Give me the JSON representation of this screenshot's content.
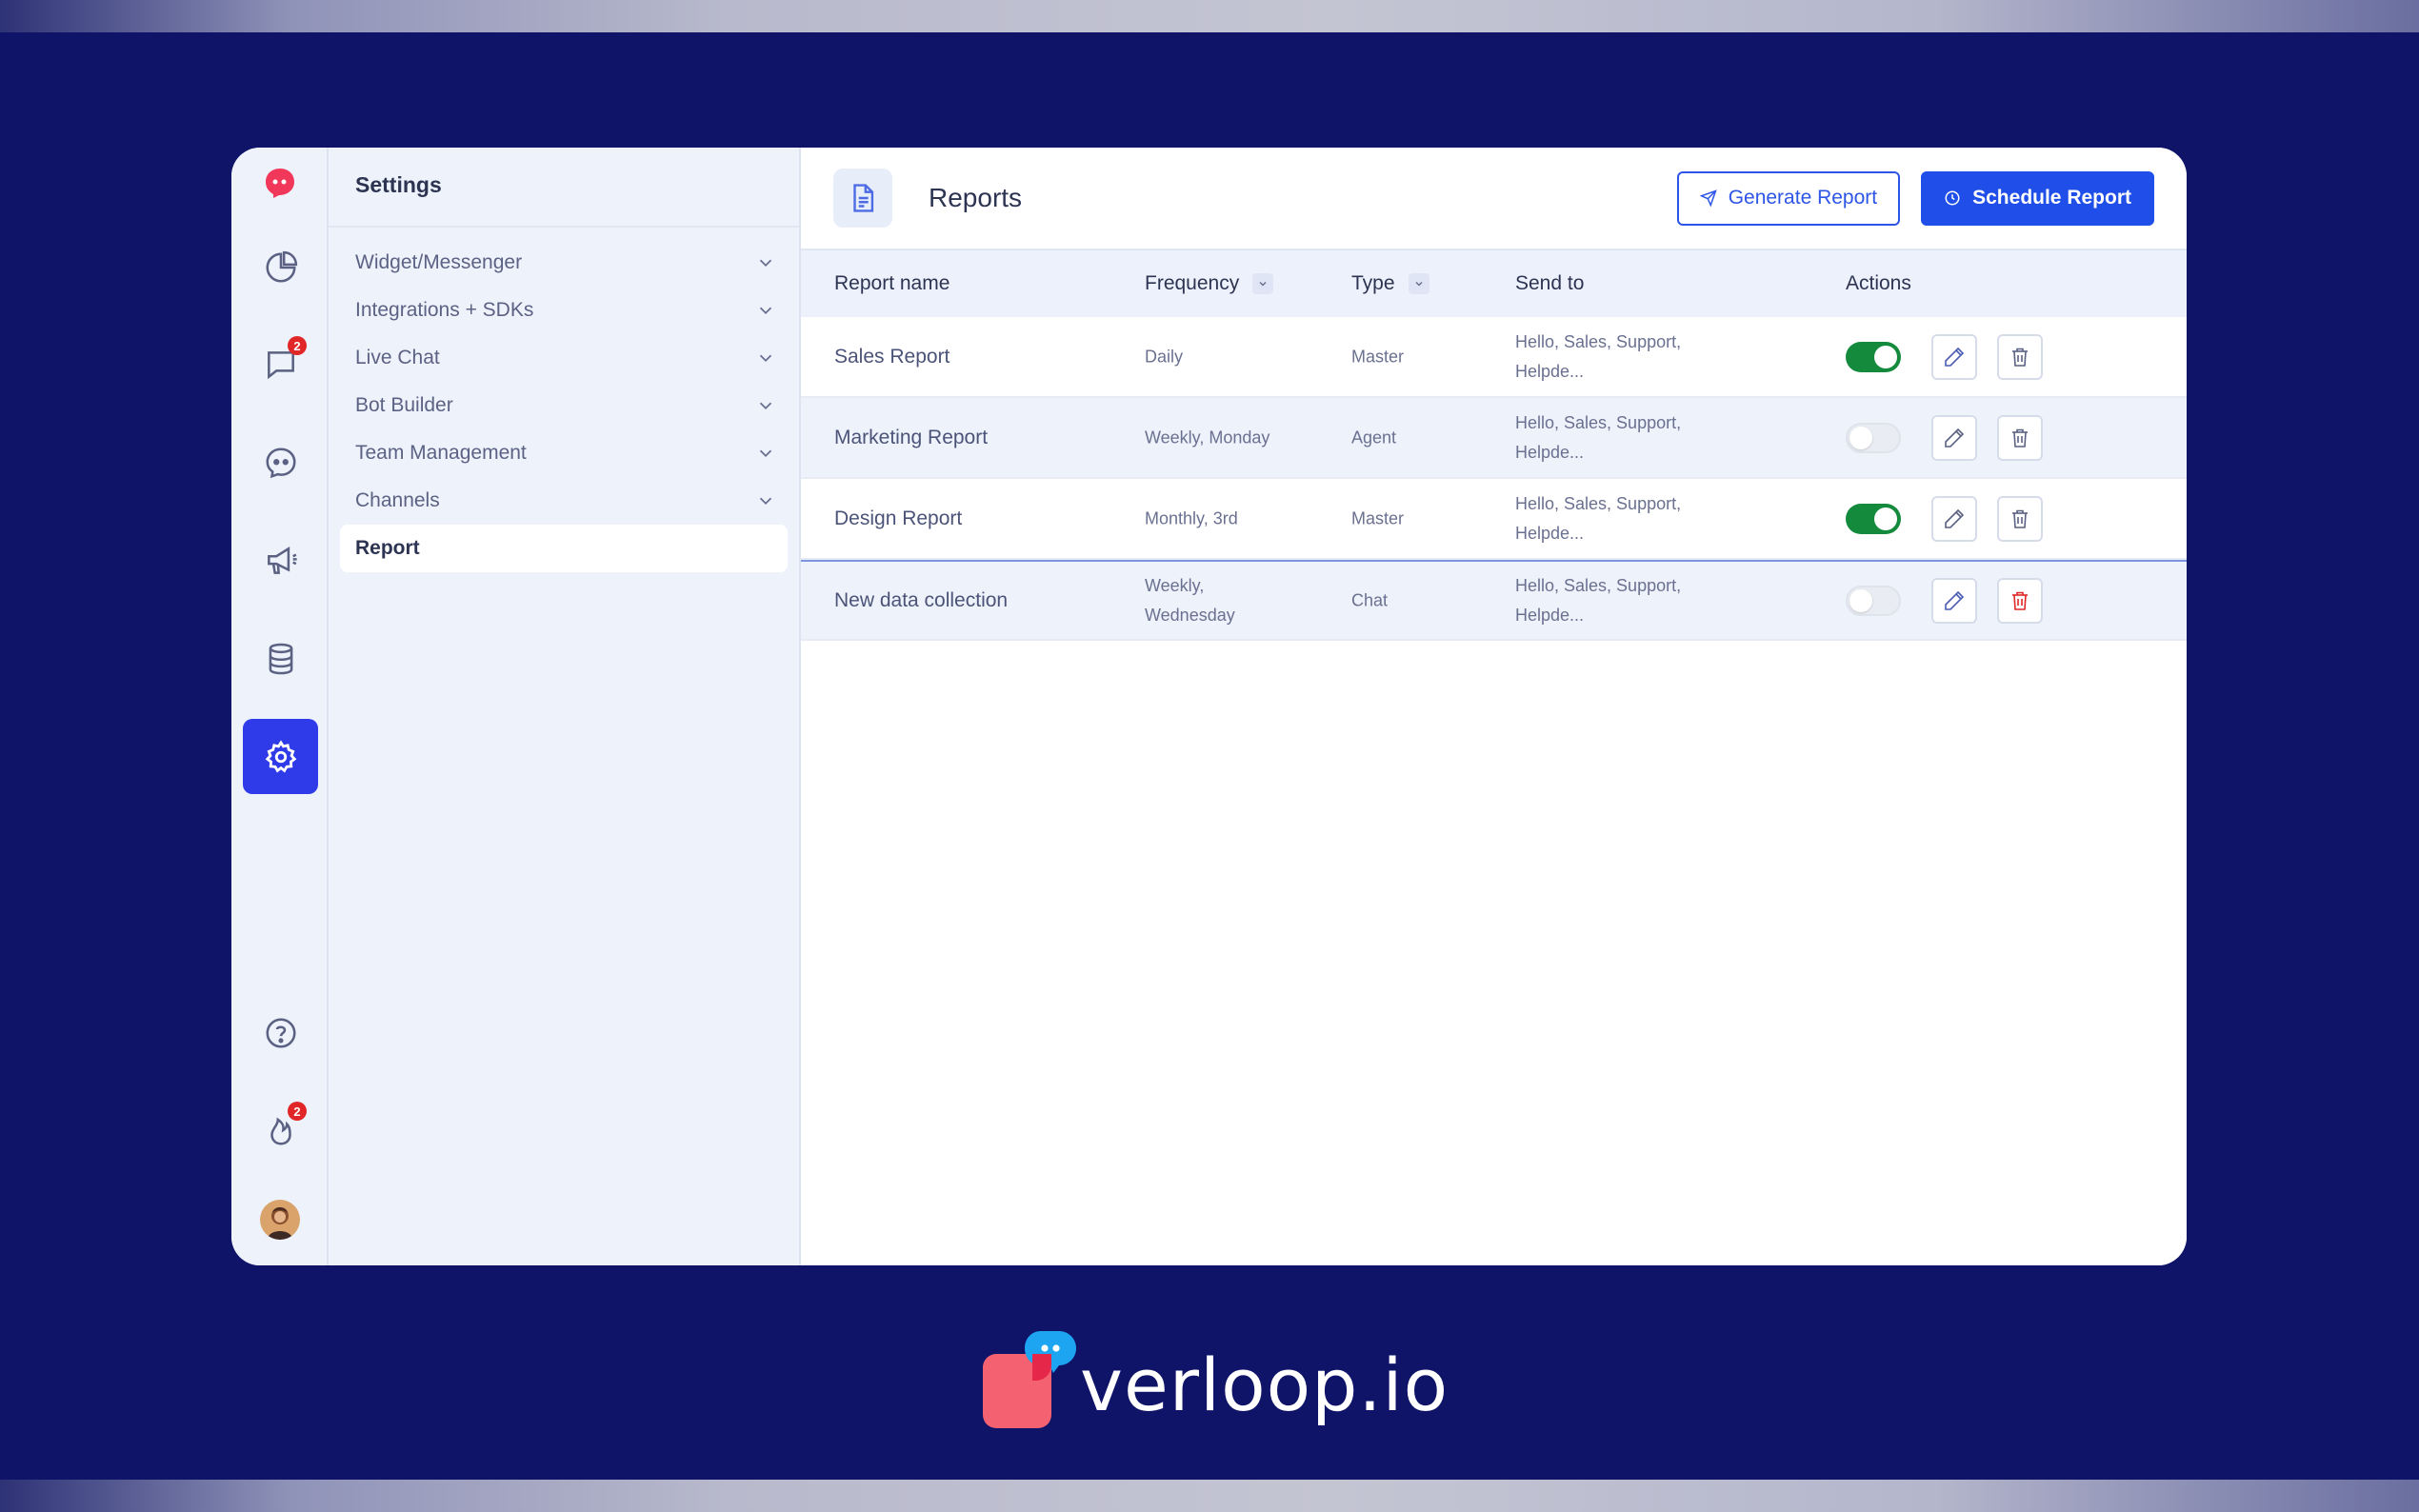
{
  "settings": {
    "title": "Settings",
    "menu": [
      {
        "label": "Widget/Messenger"
      },
      {
        "label": "Integrations + SDKs"
      },
      {
        "label": "Live Chat"
      },
      {
        "label": "Bot Builder"
      },
      {
        "label": "Team Management"
      },
      {
        "label": "Channels"
      },
      {
        "label": "Report"
      }
    ]
  },
  "rail": {
    "chat_badge": "2",
    "notif_badge": "2"
  },
  "main": {
    "title": "Reports",
    "generate_label": "Generate Report",
    "schedule_label": "Schedule Report",
    "columns": {
      "name": "Report name",
      "frequency": "Frequency",
      "type": "Type",
      "send_to": "Send to",
      "actions": "Actions"
    },
    "rows": [
      {
        "name": "Sales Report",
        "frequency": "Daily",
        "type": "Master",
        "send_to": "Hello, Sales, Support, Helpde...",
        "enabled": true
      },
      {
        "name": "Marketing Report",
        "frequency": "Weekly, Monday",
        "type": "Agent",
        "send_to": "Hello, Sales, Support, Helpde...",
        "enabled": false
      },
      {
        "name": "Design Report",
        "frequency": "Monthly, 3rd",
        "type": "Master",
        "send_to": "Hello, Sales, Support, Helpde...",
        "enabled": true
      },
      {
        "name": "New data collection",
        "frequency": "Weekly, Wednesday",
        "type": "Chat",
        "send_to": "Hello, Sales, Support, Helpde...",
        "enabled": false
      }
    ]
  },
  "brand": {
    "name": "verloop.io"
  },
  "colors": {
    "background": "#0f1468",
    "accent": "#1f4fe8",
    "active_rail": "#2f3be8",
    "toggle_on": "#138a3c",
    "badge": "#e02626",
    "delete_active": "#e02626"
  }
}
